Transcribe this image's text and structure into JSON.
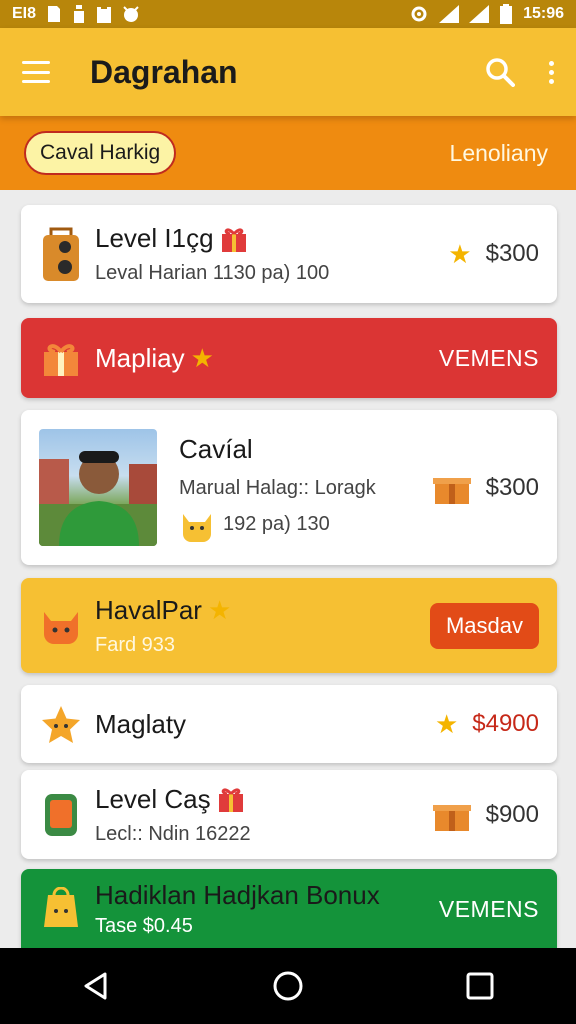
{
  "status_bar": {
    "left_text": "E​I8",
    "time": "15:96"
  },
  "app_bar": {
    "title": "Dagrahan"
  },
  "sub_bar": {
    "chip_label": "Caval Harkig",
    "right_label": "Lenoliany"
  },
  "cards": [
    {
      "title": "Level I1çg",
      "subtitle": "Leval Harian 1130 pa) 100",
      "price": "$300"
    },
    {
      "title": "Mapliay",
      "action": "VEMENS"
    },
    {
      "title": "Cavíal",
      "subtitle": "Marual Halag:: Loragk",
      "subtitle2": "192 pa) 130",
      "price": "$300"
    },
    {
      "title": "HavalPar",
      "subtitle": "Fard 933",
      "button": "Masdav"
    },
    {
      "title": "Maglaty",
      "price": "$4900"
    },
    {
      "title": "Level Caş",
      "subtitle": "Lecl:: Ndin 16222",
      "price": "$900"
    },
    {
      "title": "Hadiklan Hadjkan Bonux",
      "subtitle": "Tase $0.45",
      "action": "VEMENS"
    }
  ],
  "nav": {
    "back": "back-icon",
    "home": "home-icon",
    "recents": "recents-icon"
  },
  "colors": {
    "app_bar": "#f6c033",
    "sub_bar": "#ef8b10",
    "red_card": "#db3534",
    "green_card": "#14933a",
    "accent_button": "#e24b17"
  }
}
